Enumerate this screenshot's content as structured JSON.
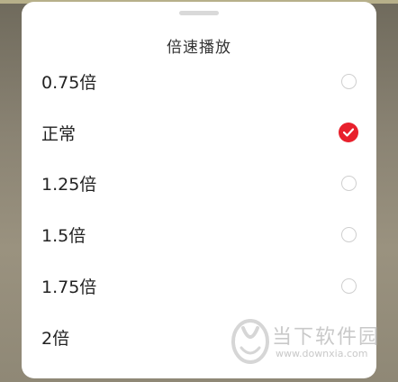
{
  "sheet": {
    "title": "倍速播放",
    "selected_index": 1,
    "options": [
      {
        "label": "0.75倍",
        "checked": false
      },
      {
        "label": "正常",
        "checked": true
      },
      {
        "label": "1.25倍",
        "checked": false
      },
      {
        "label": "1.5倍",
        "checked": false
      },
      {
        "label": "1.75倍",
        "checked": false
      },
      {
        "label": "2倍",
        "checked": false
      }
    ]
  },
  "watermark": {
    "brand": "当下软件园",
    "url": "www.downxia.com"
  },
  "colors": {
    "accent": "#e8202c",
    "sheet_background": "#ffffff",
    "backdrop": "#8a8373",
    "radio_border": "#cfcfcf"
  },
  "icons": {
    "selected": "check-icon",
    "handle": "drag-handle"
  }
}
